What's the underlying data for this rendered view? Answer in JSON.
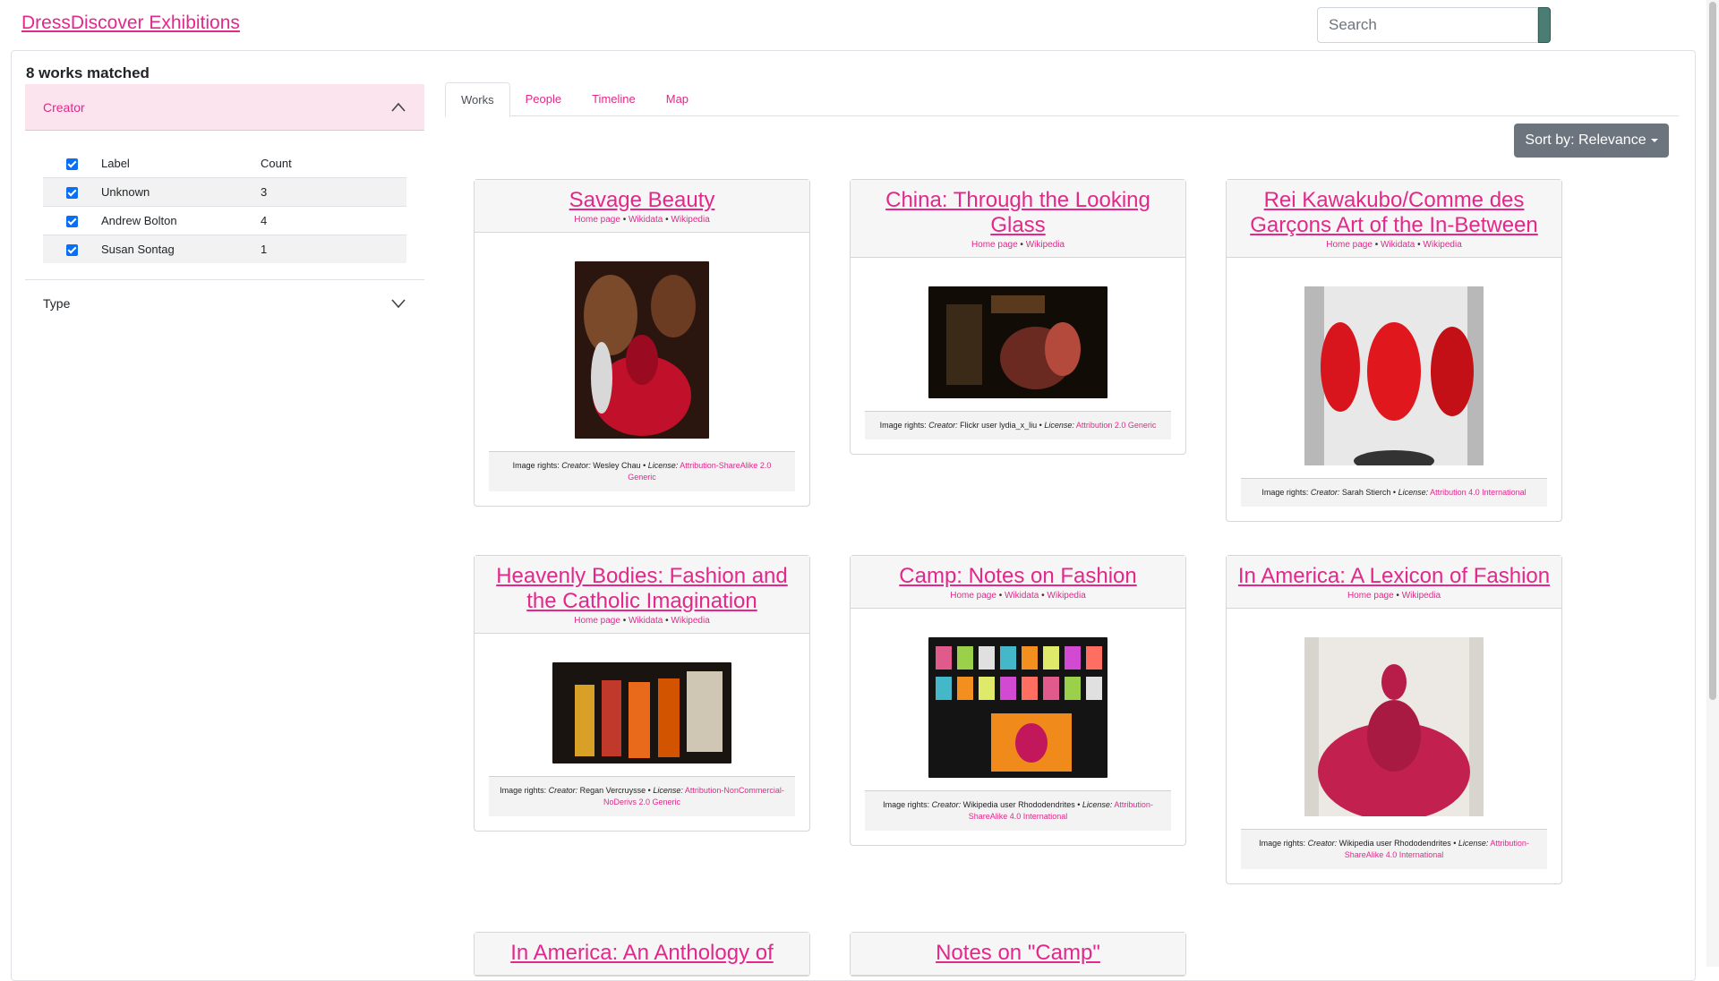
{
  "brand": "DressDiscover Exhibitions",
  "search": {
    "placeholder": "Search"
  },
  "matched": "8 works matched",
  "facets": {
    "creator": {
      "label": "Creator",
      "columns": [
        "Label",
        "Count"
      ],
      "rows": [
        {
          "label": "Unknown",
          "count": "3"
        },
        {
          "label": "Andrew Bolton",
          "count": "4"
        },
        {
          "label": "Susan Sontag",
          "count": "1"
        }
      ]
    },
    "type": {
      "label": "Type"
    }
  },
  "tabs": [
    "Works",
    "People",
    "Timeline",
    "Map"
  ],
  "sort_label": "Sort by: Relevance",
  "colors": {
    "accent": "#e4278b",
    "facet_bg": "#fce4ef",
    "sort_bg": "#6c757d"
  },
  "link_labels": {
    "home": "Home page",
    "wikidata": "Wikidata",
    "wikipedia": "Wikipedia",
    "sep": "•"
  },
  "rights_prefix": "Image rights:",
  "creator_label": "Creator",
  "license_label": "License",
  "works": [
    {
      "title": "Savage Beauty",
      "credit": "Wesley Chau",
      "license": "Attribution-ShareAlike 2.0 Generic",
      "photo": "savage-beauty-photo"
    },
    {
      "title": "China: Through the Looking Glass",
      "credit": "Flickr user lydia_x_liu",
      "license": "Attribution 2.0 Generic",
      "photo": "china-photo"
    },
    {
      "title": "Rei Kawakubo/Comme des Garçons Art of the In-Between",
      "credit": "Sarah Stierch",
      "license": "Attribution 4.0 International",
      "photo": "rei-kawakubo-photo"
    },
    {
      "title": "Heavenly Bodies: Fashion and the Catholic Imagination",
      "credit": "Regan Vercruysse",
      "license": "Attribution-NonCommercial-NoDerivs 2.0 Generic",
      "photo": "heavenly-bodies-photo"
    },
    {
      "title": "Camp: Notes on Fashion",
      "credit": "Wikipedia user Rhododendrites",
      "license": "Attribution-ShareAlike 4.0 International",
      "photo": "camp-photo"
    },
    {
      "title": "In America: A Lexicon of Fashion",
      "credit": "Wikipedia user Rhododendrites",
      "license": "Attribution-ShareAlike 4.0 International",
      "photo": "in-america-lexicon-photo"
    },
    {
      "title": "In America: An Anthology of",
      "photo": ""
    },
    {
      "title": "Notes on \"Camp\"",
      "photo": ""
    }
  ]
}
